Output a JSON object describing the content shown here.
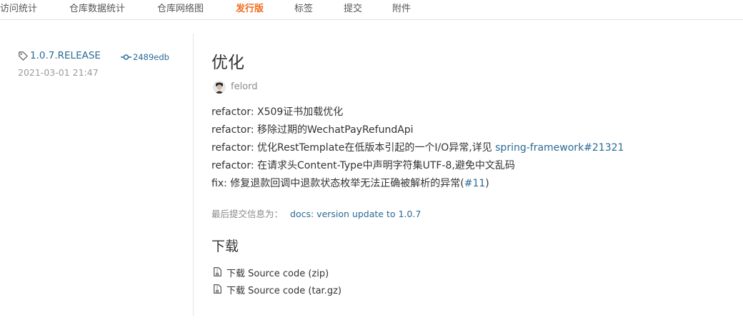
{
  "tabs": [
    {
      "label": "访问统计",
      "active": false
    },
    {
      "label": "仓库数据统计",
      "active": false
    },
    {
      "label": "仓库网络图",
      "active": false
    },
    {
      "label": "发行版",
      "active": true
    },
    {
      "label": "标签",
      "active": false
    },
    {
      "label": "提交",
      "active": false
    },
    {
      "label": "附件",
      "active": false
    }
  ],
  "release": {
    "tag": "1.0.7.RELEASE",
    "commit": "2489edb",
    "date": "2021-03-01 21:47",
    "title": "优化",
    "author": "felord"
  },
  "notes": [
    {
      "text": "refactor: X509证书加载优化",
      "link": ""
    },
    {
      "text": "refactor: 移除过期的WechatPayRefundApi",
      "link": ""
    },
    {
      "text": "refactor: 优化RestTemplate在低版本引起的一个I/O异常,详见 ",
      "link": "spring-framework#21321"
    },
    {
      "text": "refactor: 在请求头Content-Type中声明字符集UTF-8,避免中文乱码",
      "link": ""
    },
    {
      "text": "fix: 修复退款回调中退款状态枚举无法正确被解析的异常(",
      "link": "#11",
      "suffix": ")"
    }
  ],
  "last_commit": {
    "label": "最后提交信息为：",
    "message": "docs: version update to 1.0.7"
  },
  "downloads": {
    "heading": "下载",
    "items": [
      {
        "label": "下载 Source code (zip)"
      },
      {
        "label": "下载 Source code (tar.gz)"
      }
    ]
  },
  "colors": {
    "link": "#2b6a96",
    "active_tab": "#f26b1d",
    "muted": "#9a9a9a"
  }
}
